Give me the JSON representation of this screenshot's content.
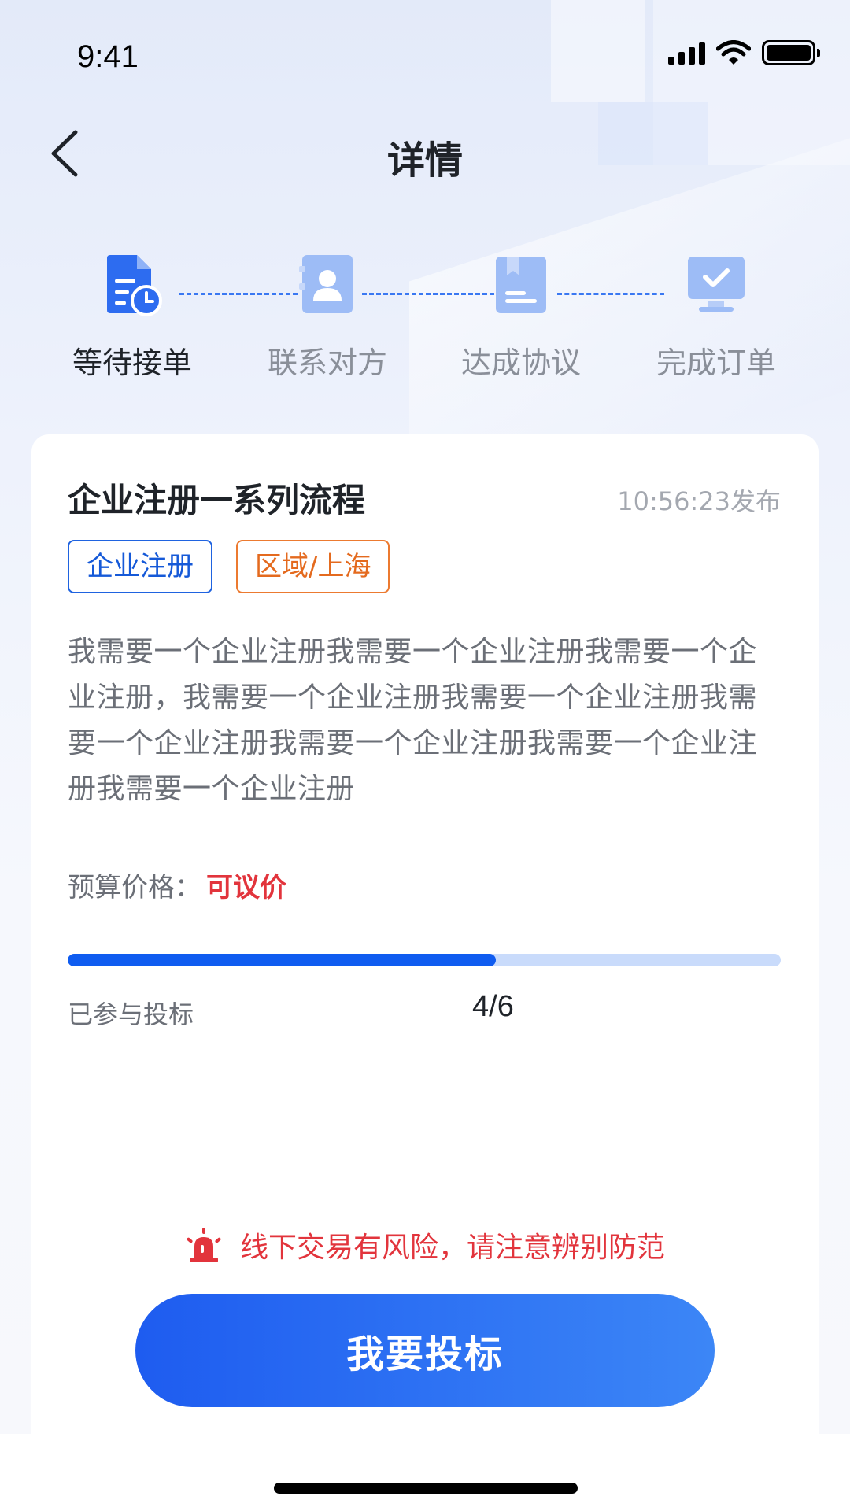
{
  "status_bar": {
    "time": "9:41"
  },
  "nav": {
    "title": "详情"
  },
  "steps": [
    {
      "label": "等待接单",
      "icon": "document-clock-icon",
      "active": true
    },
    {
      "label": "联系对方",
      "icon": "contact-card-icon",
      "active": false
    },
    {
      "label": "达成协议",
      "icon": "agreement-book-icon",
      "active": false
    },
    {
      "label": "完成订单",
      "icon": "monitor-check-icon",
      "active": false
    }
  ],
  "card": {
    "title": "企业注册一系列流程",
    "published": "10:56:23发布",
    "tags": [
      "企业注册",
      "区域/上海"
    ],
    "description": "我需要一个企业注册我需要一个企业注册我需要一个企业注册，我需要一个企业注册我需要一个企业注册我需要一个企业注册我需要一个企业注册我需要一个企业注册我需要一个企业注册",
    "budget_label": "预算价格：",
    "budget_value": "可议价",
    "progress_label": "已参与投标",
    "progress_count": "4/6",
    "progress_fraction": 0.6
  },
  "warning": {
    "text": "线下交易有风险，请注意辨别防范",
    "icon": "alarm-siren-icon"
  },
  "cta": {
    "label": "我要投标"
  },
  "colors": {
    "primary": "#0f5cf0",
    "danger": "#e2343c",
    "tag_orange": "#ec7a30"
  }
}
